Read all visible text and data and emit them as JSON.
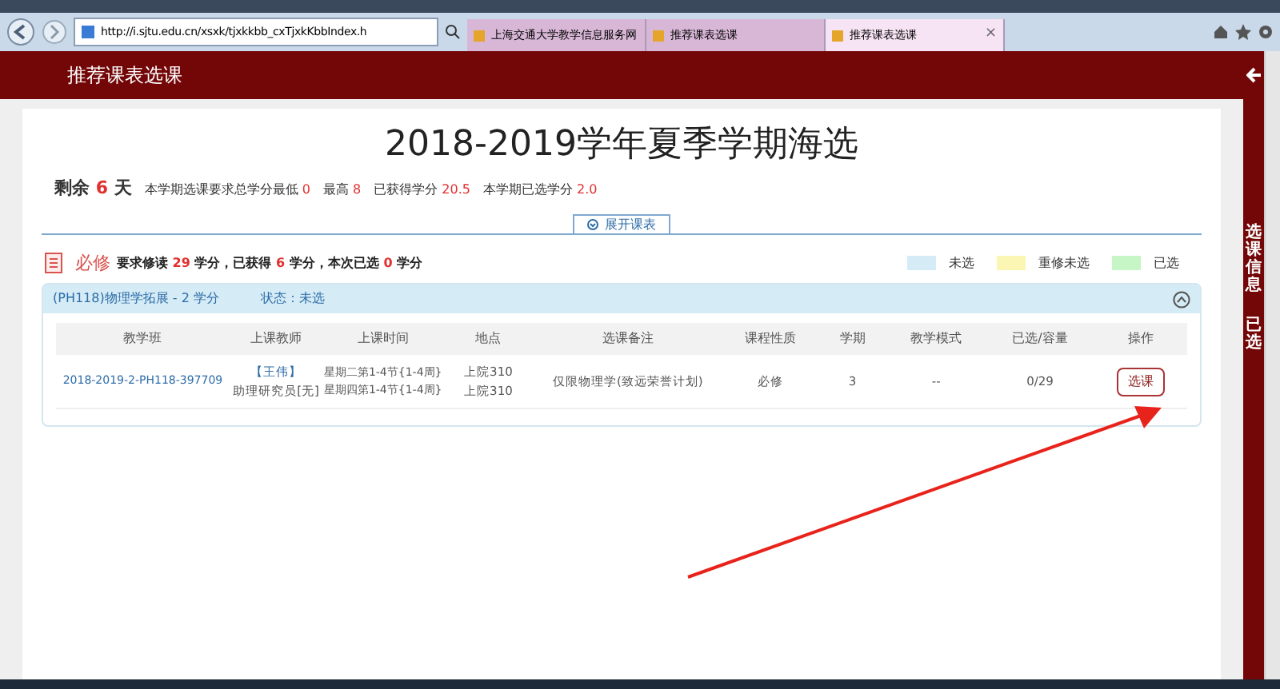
{
  "browser": {
    "address": "http://i.sjtu.edu.cn/xsxk/tjxkkbb_cxTjxkKbbIndex.h",
    "tabs": [
      {
        "title": "上海交通大学教学信息服务网",
        "selected": false
      },
      {
        "title": "推荐课表选课",
        "selected": false
      },
      {
        "title": "推荐课表选课",
        "selected": true,
        "close": "×"
      }
    ]
  },
  "header": {
    "title": "推荐课表选课"
  },
  "page": {
    "title": "2018-2019学年夏季学期海选",
    "summary": [
      {
        "label": "剩余",
        "value": "6",
        "suffix": "天",
        "kind": "days"
      },
      {
        "label": "本学期选课要求总学分最低",
        "value": "0",
        "kind": "stat"
      },
      {
        "label": "最高",
        "value": "8",
        "kind": "stat"
      },
      {
        "label": "已获得学分",
        "value": "20.5",
        "kind": "stat"
      },
      {
        "label": "本学期已选学分",
        "value": "2.0",
        "kind": "stat"
      }
    ],
    "expand_tab": "展开课表",
    "section": {
      "title": "必修",
      "parts": [
        {
          "label": "要求修读",
          "value": "29"
        },
        {
          "label": "学分，已获得",
          "value": "6"
        },
        {
          "label": "学分，本次已选",
          "value": "0"
        },
        {
          "label": "学分"
        }
      ]
    },
    "legend": [
      {
        "label": "未选",
        "color": "#d5ebf5"
      },
      {
        "label": "重修未选",
        "color": "#fbf6b4"
      },
      {
        "label": "已选",
        "color": "#c6f5c6"
      }
    ],
    "course": {
      "code": "(PH118)",
      "name": "物理学拓展",
      "credits": "- 2 学分",
      "status": "状态：未选",
      "expanded": true
    },
    "table": {
      "columns": [
        "教学班",
        "上课教师",
        "上课时间",
        "地点",
        "选课备注",
        "课程性质",
        "学期",
        "教学模式",
        "已选/容量",
        "操作"
      ],
      "rows": [
        {
          "class": "2018-2019-2-PH118-397709",
          "teacher": "【王伟】",
          "teacher_title": "助理研究员[无]",
          "times": [
            "星期二第1-4节{1-4周}",
            "星期四第1-4节{1-4周}"
          ],
          "places": [
            "上院310",
            "上院310"
          ],
          "note": "仅限物理学(致远荣誉计划)",
          "nature": "必修",
          "term": "3",
          "mode": "--",
          "capacity": "0/29",
          "action": "选课"
        }
      ]
    }
  },
  "side_panel": {
    "items": [
      "选课信息",
      "已选"
    ]
  }
}
